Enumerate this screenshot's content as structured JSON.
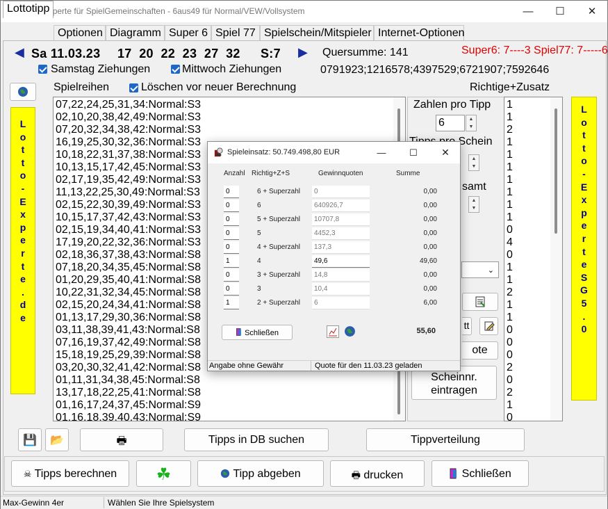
{
  "window": {
    "title": "Lotto-Experte für SpielGemeinschaften - 6aus49 für Normal/VEW/Vollsystem",
    "minimize": "—",
    "maximize": "☐",
    "close": "✕"
  },
  "tabs": [
    {
      "label": "Lottotipp",
      "active": true
    },
    {
      "label": "Optionen"
    },
    {
      "label": "Diagramm"
    },
    {
      "label": "Super 6"
    },
    {
      "label": "Spiel 77"
    },
    {
      "label": "Spielschein/Mitspieler"
    },
    {
      "label": "Internet-Optionen"
    }
  ],
  "draw": {
    "prev_arrow": "◀",
    "next_arrow": "▶",
    "date": "Sa 11.03.23",
    "numbers": "17  20  22  23  27  32",
    "superzahl": "S:7",
    "quersumme_label": "Quersumme: 141",
    "super_info": "Super6: 7----3 Spiel77: 7-----6",
    "codes": "0791923;1216578;4397529;6721907;7592646",
    "check_saturday": "Samstag Ziehungen",
    "check_wednesday": "Mittwoch Ziehungen"
  },
  "left_panel": {
    "globe_btn": "🌐",
    "banner_text": "Lotto-Experte.de",
    "header": "Spielreihen",
    "clear_check": "Löschen vor neuer Berechnung",
    "rows": [
      "07,22,24,25,31,34:Normal:S3",
      "02,10,20,38,42,49:Normal:S3",
      "07,20,32,34,38,42:Normal:S3",
      "16,19,25,30,32,36:Normal:S3",
      "10,18,22,31,37,38:Normal:S3",
      "10,13,15,17,42,45:Normal:S3",
      "02,17,19,35,42,49:Normal:S3",
      "11,13,22,25,30,49:Normal:S3",
      "02,15,22,30,39,49:Normal:S3",
      "10,15,17,37,42,43:Normal:S3",
      "02,15,19,34,40,41:Normal:S3",
      "17,19,20,22,32,36:Normal:S3",
      "02,18,36,37,38,43:Normal:S8",
      "07,18,20,34,35,45:Normal:S8",
      "01,20,29,35,40,41:Normal:S8",
      "10,22,31,32,34,45:Normal:S8",
      "02,15,20,24,34,41:Normal:S8",
      "01,13,17,29,30,36:Normal:S8",
      "03,11,38,39,41,43:Normal:S8",
      "07,16,19,37,42,49:Normal:S8",
      "15,18,19,25,29,39:Normal:S8",
      "03,20,30,32,41,42:Normal:S8",
      "01,11,31,34,38,45:Normal:S8",
      "13,17,18,22,25,41:Normal:S8",
      "01,16,17,24,37,45:Normal:S9",
      "01,16,18,39,40,43:Normal:S9"
    ]
  },
  "right_panel": {
    "header": "Richtige+Zusatz",
    "zahlen_pro_tipp_label": "Zahlen pro Tipp",
    "zahlen_pro_tipp_value": "6",
    "tipps_pro_schein_label": "Tipps pro Schein",
    "gesamt_label": "samt",
    "quote_btn": "ote",
    "scheinnr_btn": "Scheinnr. eintragen",
    "banner_text": "Lotto-Experte SG 5.0",
    "richtige": [
      "1",
      "1",
      "2",
      "1",
      "1",
      "1",
      "1",
      "1",
      "1",
      "1",
      "0",
      "4",
      "0",
      "1",
      "1",
      "2",
      "1",
      "1",
      "0",
      "0",
      "0",
      "2",
      "0",
      "2",
      "1",
      "0"
    ]
  },
  "bottom": {
    "save_icon": "💾",
    "open_icon": "📂",
    "print_icon": "🖶",
    "search_db": "Tipps in DB suchen",
    "tippverteilung": "Tippverteilung",
    "calc": "Tipps berechnen",
    "clover": "☘",
    "tipp_abgeben": "Tipp abgeben",
    "drucken": "drucken",
    "schliessen": "Schließen"
  },
  "status": {
    "left": "Max-Gewinn 4er",
    "right": "Wählen Sie Ihre Spielsystem"
  },
  "dialog": {
    "title": "Spieleinsatz: 50.749.498,80 EUR",
    "col_anzahl": "Anzahl",
    "col_richtige": "Richtig+Z+S",
    "col_quote": "Gewinnquoten",
    "col_summe": "Summe",
    "rows": [
      {
        "anzahl": "0",
        "label": "6 + Superzahl",
        "quote": "0",
        "summe": "0,00"
      },
      {
        "anzahl": "0",
        "label": "6",
        "quote": "640926,7",
        "summe": "0,00"
      },
      {
        "anzahl": "0",
        "label": "5 + Superzahl",
        "quote": "10707,8",
        "summe": "0,00"
      },
      {
        "anzahl": "0",
        "label": "5",
        "quote": "4452,3",
        "summe": "0,00"
      },
      {
        "anzahl": "0",
        "label": "4 + Superzahl",
        "quote": "137,3",
        "summe": "0,00"
      },
      {
        "anzahl": "1",
        "label": "4",
        "quote": "49,6",
        "summe": "49,60"
      },
      {
        "anzahl": "0",
        "label": "3 + Superzahl",
        "quote": "14,8",
        "summe": "0,00"
      },
      {
        "anzahl": "0",
        "label": "3",
        "quote": "10,4",
        "summe": "0,00"
      },
      {
        "anzahl": "1",
        "label": "2 + Superzahl",
        "quote": "6",
        "summe": "6,00"
      }
    ],
    "close_btn": "Schließen",
    "total": "55,60",
    "status_left": "Angabe ohne Gewähr",
    "status_right": "Quote für den 11.03.23 geladen"
  }
}
